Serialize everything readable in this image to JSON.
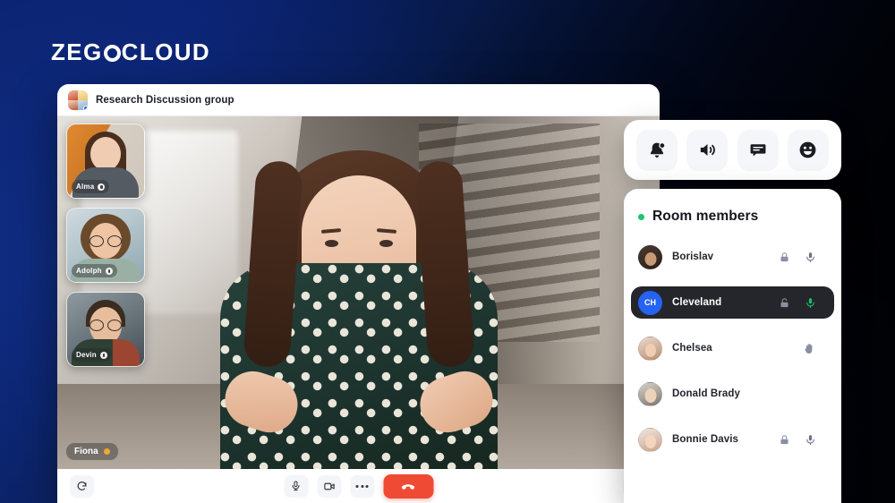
{
  "brand": {
    "name_part1": "ZEG",
    "name_part2": "CLOUD"
  },
  "app": {
    "title": "Research Discussion group",
    "group_avatar_icon": "group-avatar-icon"
  },
  "stage": {
    "active_speaker": {
      "name": "Fiona",
      "status_color": "#f0a830"
    },
    "thumbnails": [
      {
        "name": "Alma",
        "mic_icon": "mic-icon"
      },
      {
        "name": "Adolph",
        "mic_icon": "mic-icon"
      },
      {
        "name": "Devin",
        "mic_icon": "mic-icon"
      }
    ]
  },
  "controls": {
    "rotate_icon": "rotate-camera-icon",
    "mic_icon": "microphone-icon",
    "camera_icon": "camera-icon",
    "more_icon": "more-options-icon",
    "hangup_icon": "hangup-phone-icon",
    "settings_icon": "settings-icon"
  },
  "toolbar": {
    "buttons": [
      {
        "icon": "bell-notification-icon",
        "has_badge": true
      },
      {
        "icon": "speaker-volume-icon",
        "has_badge": false
      },
      {
        "icon": "chat-bubble-icon",
        "has_badge": false
      },
      {
        "icon": "emoji-smiley-icon",
        "has_badge": false
      }
    ]
  },
  "members_panel": {
    "title": "Room members",
    "status_color": "#1fc46b",
    "members": [
      {
        "name": "Borislav",
        "avatar_type": "photo",
        "initials": "",
        "active": false,
        "lock": "locked",
        "mic": "muted",
        "hand_raised": false
      },
      {
        "name": "Cleveland",
        "avatar_type": "initials",
        "initials": "CH",
        "active": true,
        "lock": "unlocked",
        "mic": "active",
        "hand_raised": false
      },
      {
        "name": "Chelsea",
        "avatar_type": "photo",
        "initials": "",
        "active": false,
        "lock": "none",
        "mic": "none",
        "hand_raised": true
      },
      {
        "name": "Donald Brady",
        "avatar_type": "photo",
        "initials": "",
        "active": false,
        "lock": "none",
        "mic": "none",
        "hand_raised": false
      },
      {
        "name": "Bonnie Davis",
        "avatar_type": "photo",
        "initials": "",
        "active": false,
        "lock": "locked",
        "mic": "muted",
        "hand_raised": false
      }
    ]
  },
  "colors": {
    "accent_blue": "#2563f0",
    "hangup_red": "#ef4a34",
    "mic_green": "#18c06a",
    "online_green": "#1fc46b"
  }
}
